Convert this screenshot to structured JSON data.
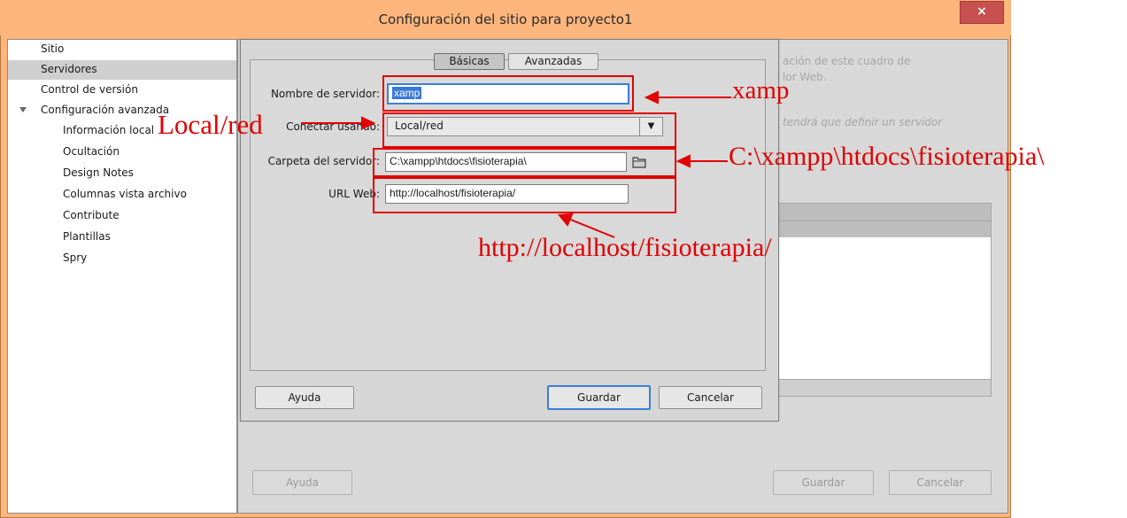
{
  "window": {
    "title": "Configuración del sitio para proyecto1",
    "close_label": "×"
  },
  "sidebar": {
    "items": [
      {
        "label": "Sitio"
      },
      {
        "label": "Servidores"
      },
      {
        "label": "Control de versión"
      },
      {
        "label": "Configuración avanzada"
      },
      {
        "label": "Información local"
      },
      {
        "label": "Ocultación"
      },
      {
        "label": "Design Notes"
      },
      {
        "label": "Columnas vista archivo"
      },
      {
        "label": "Contribute"
      },
      {
        "label": "Plantillas"
      },
      {
        "label": "Spry"
      }
    ]
  },
  "background": {
    "text_line1": "ación de este cuadro de",
    "text_line2": "lor Web.",
    "text_line3": "tendrá que definir un servidor",
    "help_label": "Ayuda",
    "save_label": "Guardar",
    "cancel_label": "Cancelar"
  },
  "dialog": {
    "tabs": {
      "basic": "Básicas",
      "advanced": "Avanzadas"
    },
    "server_name": {
      "label": "Nombre de servidor:",
      "value": "xamp"
    },
    "connect": {
      "label": "Conectar usando:",
      "value": "Local/red"
    },
    "folder": {
      "label": "Carpeta del servidor:",
      "value": "C:\\xampp\\htdocs\\fisioterapia\\"
    },
    "url": {
      "label": "URL Web:",
      "value": "http://localhost/fisioterapia/"
    },
    "help_label": "Ayuda",
    "save_label": "Guardar",
    "cancel_label": "Cancelar"
  },
  "annotations": {
    "server_name": "xamp",
    "connect": "Local/red",
    "folder": "C:\\xampp\\htdocs\\fisioterapia\\",
    "url": "http://localhost/fisioterapia/",
    "color": "#e00000"
  }
}
